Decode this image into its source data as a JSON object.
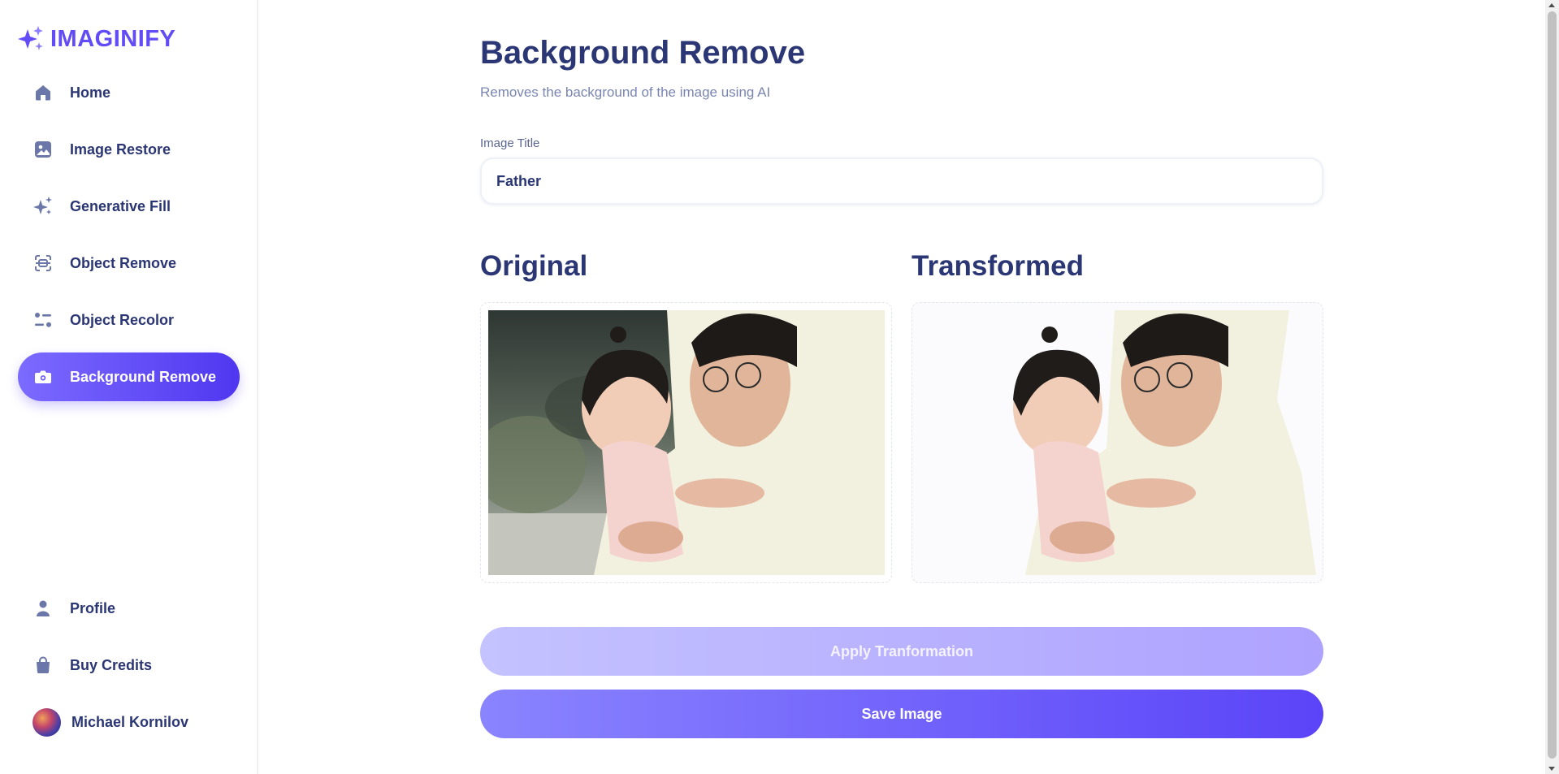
{
  "app": {
    "name": "IMAGINIFY",
    "accent": "#624cf5",
    "text_color": "#2b3674"
  },
  "sidebar": {
    "items": [
      {
        "label": "Home",
        "icon": "home-icon",
        "active": false
      },
      {
        "label": "Image Restore",
        "icon": "image-icon",
        "active": false
      },
      {
        "label": "Generative Fill",
        "icon": "sparkles-icon",
        "active": false
      },
      {
        "label": "Object Remove",
        "icon": "scan-icon",
        "active": false
      },
      {
        "label": "Object Recolor",
        "icon": "filter-icon",
        "active": false
      },
      {
        "label": "Background Remove",
        "icon": "camera-icon",
        "active": true
      }
    ],
    "bottom_items": [
      {
        "label": "Profile",
        "icon": "user-icon"
      },
      {
        "label": "Buy Credits",
        "icon": "bag-icon"
      }
    ],
    "user": {
      "name": "Michael Kornilov",
      "avatar": "avatar-icon"
    }
  },
  "main": {
    "title": "Background Remove",
    "subtitle": "Removes the background of the image using AI",
    "form": {
      "title_label": "Image Title",
      "title_value": "Father"
    },
    "original_heading": "Original",
    "transformed_heading": "Transformed",
    "apply_button": "Apply Tranformation",
    "save_button": "Save Image"
  }
}
